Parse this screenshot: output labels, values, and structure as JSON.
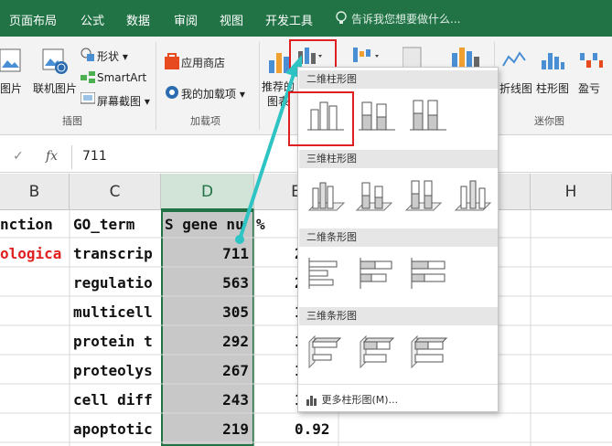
{
  "tabs": [
    "页面布局",
    "公式",
    "数据",
    "审阅",
    "视图",
    "开发工具"
  ],
  "tell_me": "告诉我您想要做什么...",
  "ribbon": {
    "pictures": "图片",
    "online_pictures": "联机图片",
    "shapes": "形状",
    "smartart": "SmartArt",
    "screenshot": "屏幕截图",
    "illustrations_group": "插图",
    "app_store": "应用商店",
    "my_addins": "我的加载项",
    "addins_group": "加载项",
    "recommended_1": "推荐的",
    "recommended_2": "图表",
    "sparkline_line": "折线图",
    "sparkline_column": "柱形图",
    "sparkline_winloss": "盈亏",
    "sparkline_group": "迷你图"
  },
  "formula_bar": {
    "fx": "fx",
    "value": "711"
  },
  "columns": [
    "B",
    "C",
    "D",
    "E",
    "H"
  ],
  "header_row": {
    "b": "nction",
    "c": "GO_term",
    "d": "S gene nu",
    "e": "%"
  },
  "row1_b": "ologica",
  "rows": [
    {
      "c": "transcrip",
      "d": "711",
      "e": "2"
    },
    {
      "c": "regulatio",
      "d": "563",
      "e": "2"
    },
    {
      "c": "multicell",
      "d": "305",
      "e": "1"
    },
    {
      "c": "protein t",
      "d": "292",
      "e": "1"
    },
    {
      "c": "proteolys",
      "d": "267",
      "e": "1"
    },
    {
      "c": "cell diff",
      "d": "243",
      "e": "1"
    },
    {
      "c": "apoptotic",
      "d": "219",
      "e": "0.92"
    }
  ],
  "dropdown": {
    "section_2d_column": "二维柱形图",
    "section_3d_column": "三维柱形图",
    "section_2d_bar": "二维条形图",
    "section_3d_bar": "三维条形图",
    "more_charts": "更多柱形图(M)..."
  },
  "colors": {
    "excel_green": "#217346",
    "highlight_red": "#e02020",
    "arrow_cyan": "#2ec4c4",
    "red_text": "#e02020"
  }
}
